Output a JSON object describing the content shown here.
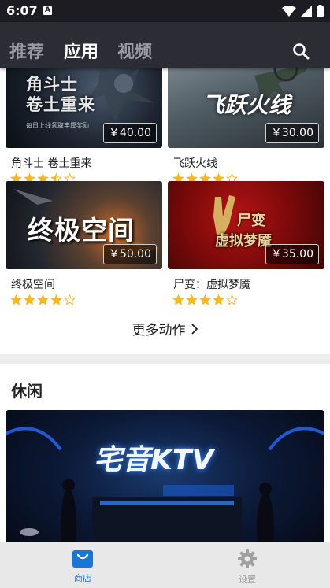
{
  "status_bar": {
    "time": "6:07",
    "notification_badge": "A"
  },
  "top_nav": {
    "tabs": [
      {
        "label": "推荐",
        "active": false
      },
      {
        "label": "应用",
        "active": true
      },
      {
        "label": "视频",
        "active": false
      }
    ],
    "search_icon": "search-icon"
  },
  "action_section": {
    "games": [
      {
        "name": "角斗士 卷土重来",
        "price": "￥40.00",
        "rating": 3.5,
        "art_text": "角斗士 卷土重来",
        "art_subtext": "每日上线领取丰厚奖励"
      },
      {
        "name": "飞跃火线",
        "price": "￥30.00",
        "rating": 4,
        "art_text": "飞跃火线"
      },
      {
        "name": "终极空间",
        "price": "￥50.00",
        "rating": 4,
        "art_text": "终极空间"
      },
      {
        "name": "尸变：虚拟梦魇",
        "price": "￥35.00",
        "rating": 4,
        "art_text": "尸变 虚拟梦魇"
      }
    ],
    "more_label": "更多动作"
  },
  "casual_section": {
    "title": "休闲",
    "banner_text": "宅音KTV"
  },
  "bottom_nav": {
    "items": [
      {
        "label": "商店",
        "icon": "store-bag-icon",
        "active": true
      },
      {
        "label": "设置",
        "icon": "gear-icon",
        "active": false
      }
    ]
  },
  "colors": {
    "accent": "#1976d2",
    "star": "#f5b820",
    "nav_bg": "#2c2c34"
  }
}
